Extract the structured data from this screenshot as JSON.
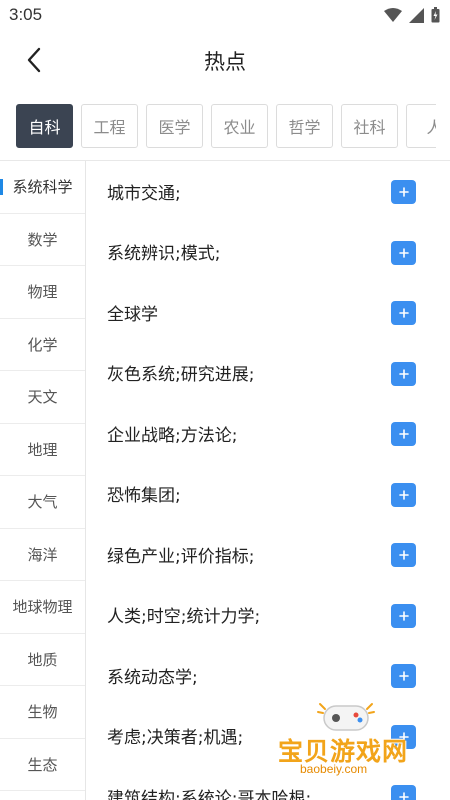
{
  "status_bar": {
    "time": "3:05"
  },
  "header": {
    "title": "热点"
  },
  "tabs": [
    "自科",
    "工程",
    "医学",
    "农业",
    "哲学",
    "社科",
    "人"
  ],
  "sidebar": [
    "系统科学",
    "数学",
    "物理",
    "化学",
    "天文",
    "地理",
    "大气",
    "海洋",
    "地球物理",
    "地质",
    "生物",
    "生态"
  ],
  "topics": [
    "城市交通;",
    "系统辨识;模式;",
    "全球学",
    "灰色系统;研究进展;",
    "企业战略;方法论;",
    "恐怖集团;",
    "绿色产业;评价指标;",
    "人类;时空;统计力学;",
    "系统动态学;",
    "考虑;决策者;机遇;",
    "建筑结构;系统论;哥本哈根;"
  ],
  "watermark": {
    "text": "宝贝游戏网",
    "url": "baobeiy.com"
  },
  "colors": {
    "accent": "#3b8ff0",
    "active_tab": "#3b4452",
    "indicator": "#1e88e5"
  }
}
